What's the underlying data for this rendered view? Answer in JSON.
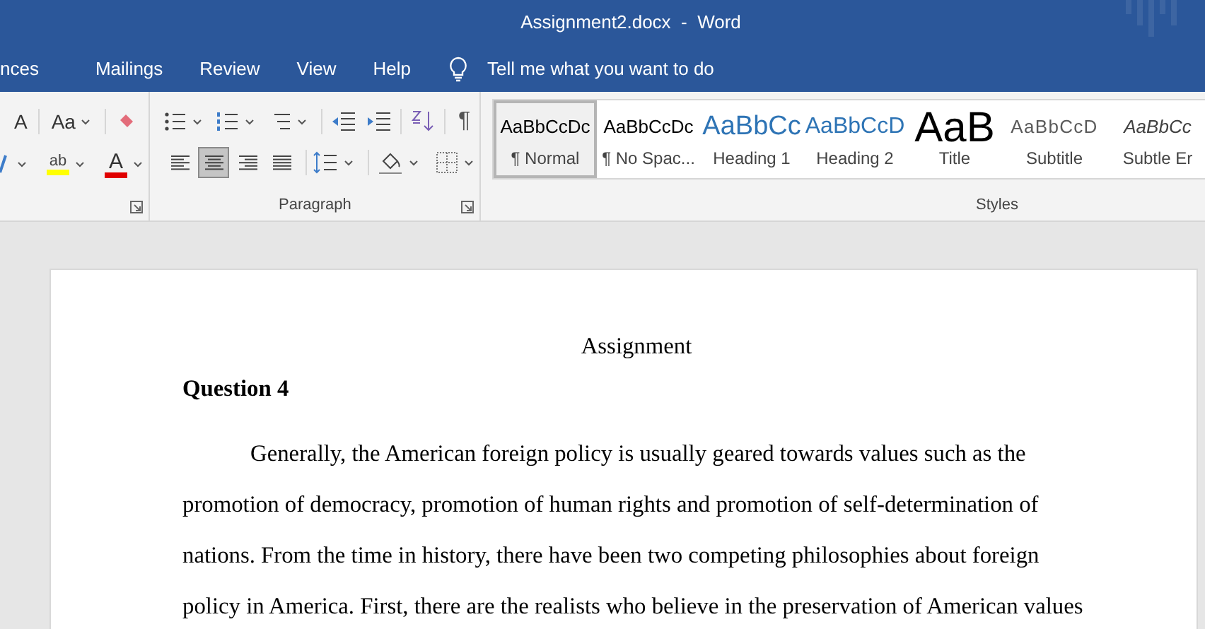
{
  "window": {
    "title": "Assignment2.docx  -  Word"
  },
  "ribbon_tabs": [
    {
      "label": "nces",
      "selected": false
    },
    {
      "label": "Mailings",
      "selected": false
    },
    {
      "label": "Review",
      "selected": false
    },
    {
      "label": "View",
      "selected": false
    },
    {
      "label": "Help",
      "selected": false
    }
  ],
  "tell_me": {
    "placeholder": "Tell me what you want to do"
  },
  "font_group": {
    "grow_label": "A",
    "case_label": "Aa",
    "highlight_label": "ab",
    "font_color_label": "A"
  },
  "paragraph_group": {
    "title": "Paragraph",
    "alignments": [
      {
        "kind": "left",
        "selected": false
      },
      {
        "kind": "center",
        "selected": true
      },
      {
        "kind": "right",
        "selected": false
      },
      {
        "kind": "justify",
        "selected": false
      }
    ],
    "show_marks": {
      "label": "¶",
      "on": false
    }
  },
  "styles_group": {
    "title": "Styles",
    "styles": [
      {
        "kind": "normal",
        "preview": "AaBbCcDc",
        "label": "¶ Normal",
        "selected": true
      },
      {
        "kind": "normal",
        "preview": "AaBbCcDc",
        "label": "¶ No Spac...",
        "selected": false
      },
      {
        "kind": "heading1",
        "preview": "AaBbCc",
        "label": "Heading 1",
        "selected": false
      },
      {
        "kind": "heading2",
        "preview": "AaBbCcD",
        "label": "Heading 2",
        "selected": false
      },
      {
        "kind": "title",
        "preview": "AaB",
        "label": "Title",
        "selected": false
      },
      {
        "kind": "subtitle",
        "preview": "AaBbCcD",
        "label": "Subtitle",
        "selected": false
      },
      {
        "kind": "emphasis",
        "preview": "AaBbCc",
        "label": "Subtle Er",
        "selected": false
      }
    ]
  },
  "document": {
    "title": "Assignment",
    "heading": "Question 4",
    "paragraph": "Generally, the American foreign policy is usually geared towards values such as the promotion of democracy, promotion of human rights and promotion of self-determination of nations. From the time in history, there have been two competing philosophies about foreign policy in America. First, there are the realists who believe in the preservation of American values"
  }
}
